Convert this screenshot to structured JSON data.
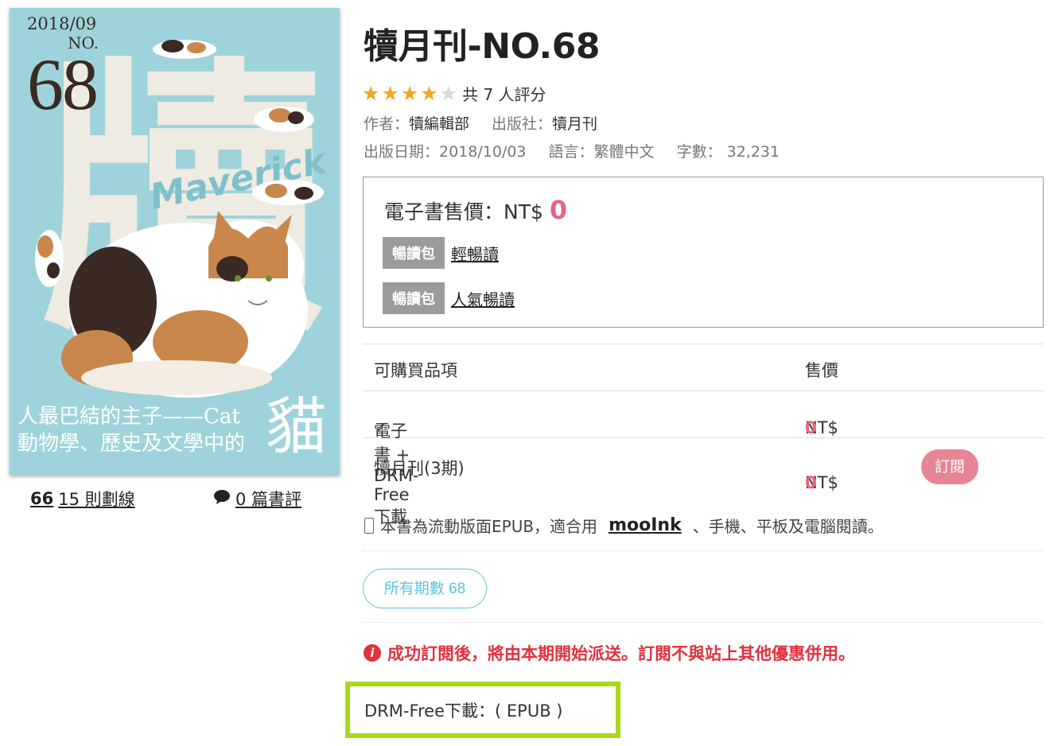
{
  "cover": {
    "date": "2018/09",
    "no_label": "NO.",
    "issue_number": "68",
    "big_char": "牘",
    "maverick_text": "Maverick",
    "tagline_line1": "人最巴結的主子——Cat",
    "tagline_line2": "動物學、歷史及文學中的",
    "cat_char": "貓"
  },
  "stats": {
    "highlights_icon": "quote-icon",
    "highlights_glyph": "66",
    "highlights_label": "15 則劃線",
    "reviews_icon": "comment-icon",
    "reviews_label": "0 篇書評"
  },
  "book": {
    "title": "犢月刊-NO.68",
    "rating": 4,
    "rating_max": 5,
    "rating_text": "共 7 人評分",
    "author_label": "作者：",
    "author": "犢編輯部",
    "publisher_label": "出版社：",
    "publisher": "犢月刊",
    "pubdate_label": "出版日期：",
    "pubdate": "2018/10/03",
    "lang_label": "語言：",
    "lang": "繁體中文",
    "words_label": "字數：",
    "words": "32,231"
  },
  "pricing": {
    "label": "電子書售價：NT$ ",
    "value": "0",
    "packages": [
      {
        "badge": "暢讀包",
        "name": "輕暢讀"
      },
      {
        "badge": "暢讀包",
        "name": "人氣暢讀"
      }
    ]
  },
  "items_table": {
    "headers": [
      "可購買品項",
      "售價"
    ],
    "rows": [
      {
        "check": "✓",
        "name": "電子書 + DRM-Free下載",
        "currency": "NT$",
        "price": "0",
        "button": ""
      },
      {
        "check": "",
        "name": "犢月刊(3期)",
        "currency": "NT$",
        "price": "0",
        "button": "訂閱"
      }
    ]
  },
  "format_note": {
    "icon": "phone-icon",
    "before": "本書為流動版面EPUB，適合用",
    "app": "mooInk",
    "after": "、手機、平板及電腦閱讀。"
  },
  "issues_button": "所有期數 68",
  "warning": {
    "icon": "info-icon",
    "text": "成功訂閱後，將由本期開始派送。訂閱不與站上其他優惠併用。"
  },
  "drm": "DRM-Free下載：( EPUB )",
  "colors": {
    "accent_pink": "#e8637f",
    "cyan": "#5cc5d9",
    "highlight_green": "#a7d91a",
    "star": "#f5a623",
    "warning_red": "#e0323c"
  }
}
